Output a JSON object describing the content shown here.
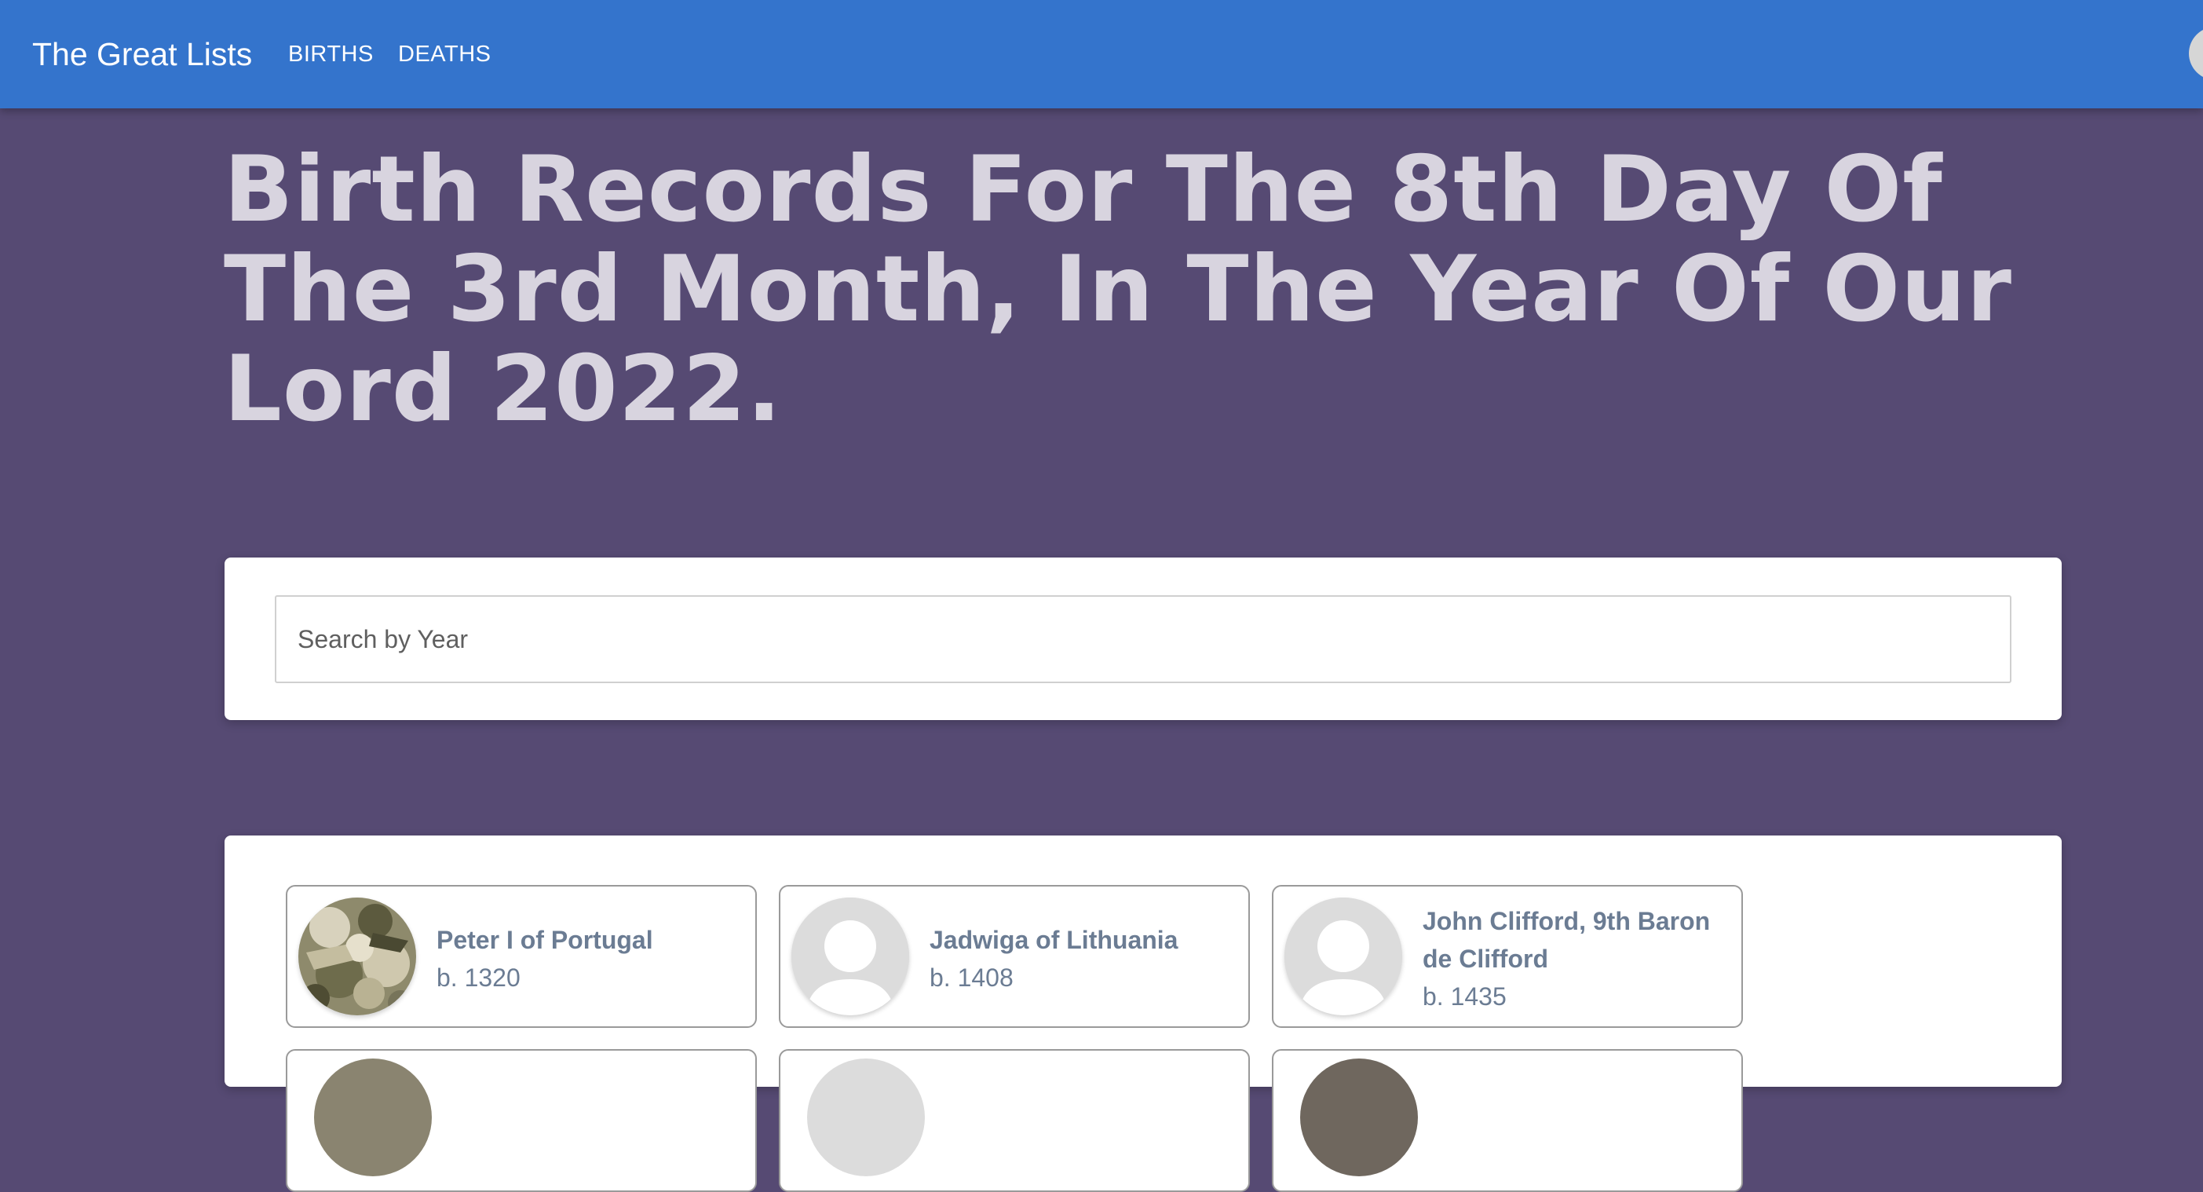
{
  "navbar": {
    "brand": "The Great Lists",
    "links": [
      {
        "label": "BIRTHS"
      },
      {
        "label": "DEATHS"
      }
    ]
  },
  "page": {
    "title": "Birth Records For The 8th Day Of The 3rd Month, In The Year Of Our Lord 2022."
  },
  "search": {
    "placeholder": "Search by Year",
    "value": ""
  },
  "results": [
    {
      "name": "Peter I of Portugal",
      "born": "b. 1320",
      "avatar": "portrait-photo"
    },
    {
      "name": "Jadwiga of Lithuania",
      "born": "b. 1408",
      "avatar": "default-user-icon"
    },
    {
      "name": "John Clifford, 9th Baron de Clifford",
      "born": "b. 1435",
      "avatar": "default-user-icon"
    }
  ],
  "colors": {
    "navbar": "#3474cc",
    "background": "#564a73",
    "title": "#d8d4df",
    "person_text": "#6b7c93"
  }
}
